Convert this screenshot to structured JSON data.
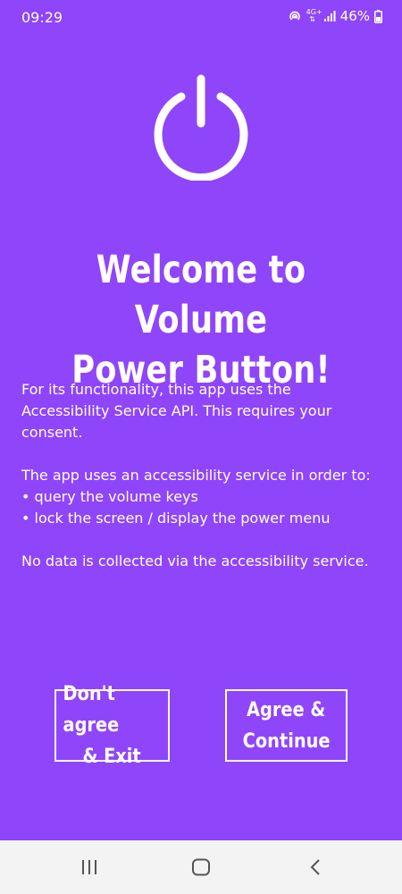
{
  "status_bar": {
    "time": "09:29",
    "network_label_top": "4G+",
    "network_label_bottom": "⇅",
    "battery": "46%",
    "icons": [
      "hotspot-icon",
      "network-4g-icon",
      "signal-icon",
      "battery-icon"
    ]
  },
  "colors": {
    "background": "#8f45f9",
    "foreground": "#ffffff",
    "nav_bar": "#f3f3f3"
  },
  "header": {
    "icon": "power-icon",
    "title_line1": "Welcome to Volume",
    "title_line2": "Power Button!"
  },
  "body": {
    "intro": "For its functionality, this app uses the Accessibility Service API. This requires your consent.",
    "uses_intro": "The app uses an accessibility service in order to:",
    "bullets": [
      "• query the volume keys",
      "• lock the screen / display the power menu"
    ],
    "privacy": "No data is collected via the accessibility service."
  },
  "buttons": {
    "disagree_line1": "Don't agree",
    "disagree_line2": "& Exit",
    "agree_line1": "Agree &",
    "agree_line2": "Continue"
  },
  "nav_bar": {
    "icons": [
      "recent-apps-icon",
      "home-icon",
      "back-icon"
    ]
  }
}
